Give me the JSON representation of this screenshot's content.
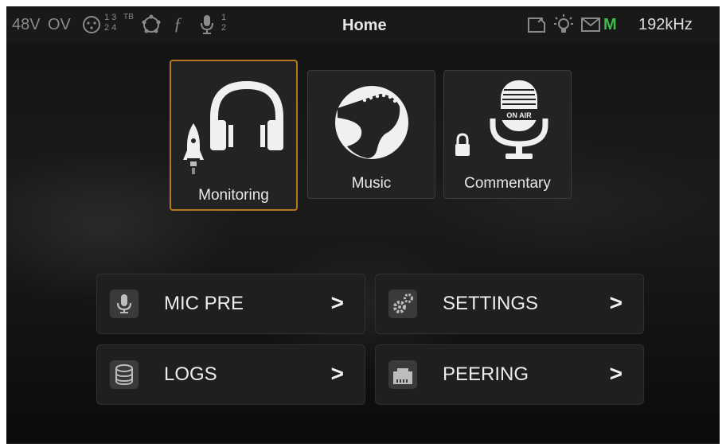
{
  "status_bar": {
    "phantom": "48V",
    "overload": "OV",
    "channels_top": "1 3",
    "channels_bottom": "2 4",
    "talkback": "TB",
    "mic_channels_top": "1",
    "mic_channels_bottom": "2",
    "title": "Home",
    "master_indicator": "M",
    "sample_rate": "192kHz",
    "icons": [
      "connector-icon",
      "network-icon",
      "function-icon",
      "microphone-icon",
      "sd-card-icon",
      "lightbulb-icon",
      "mail-icon"
    ],
    "master_color": "#3bbf4a"
  },
  "tiles": [
    {
      "label": "Monitoring",
      "icon": "headphones-icon",
      "selected": true,
      "badge": "rocket-icon"
    },
    {
      "label": "Music",
      "icon": "guitar-icon",
      "selected": false
    },
    {
      "label": "Commentary",
      "icon": "on-air-microphone-icon",
      "selected": false,
      "badge": "lock-icon",
      "icon_text": "ON AIR"
    }
  ],
  "menu": [
    {
      "label": "MIC PRE",
      "icon": "microphone-icon",
      "arrow": ">"
    },
    {
      "label": "SETTINGS",
      "icon": "gears-icon",
      "arrow": ">"
    },
    {
      "label": "LOGS",
      "icon": "database-icon",
      "arrow": ">"
    },
    {
      "label": "PEERING",
      "icon": "network-port-icon",
      "arrow": ">"
    }
  ],
  "accent_color": "#b7771f"
}
